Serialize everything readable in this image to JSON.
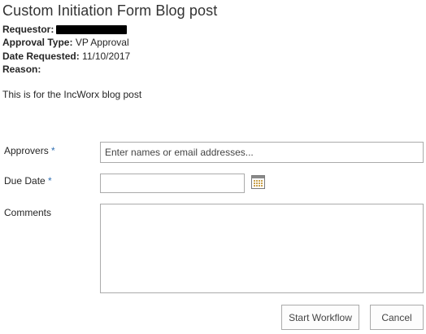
{
  "page": {
    "title": "Custom Initiation Form Blog post"
  },
  "info": {
    "requestor_label": "Requestor:",
    "approval_type_label": "Approval Type:",
    "approval_type_value": "VP Approval",
    "date_requested_label": "Date Requested:",
    "date_requested_value": "11/10/2017",
    "reason_label": "Reason:",
    "reason_value": "This is for the IncWorx blog post"
  },
  "form": {
    "approvers_label": "Approvers",
    "approvers_placeholder": "Enter names or email addresses...",
    "approvers_value": "",
    "due_date_label": "Due Date",
    "due_date_value": "",
    "comments_label": "Comments",
    "comments_value": "",
    "required_marker": "*",
    "calendar_icon": "calendar-icon"
  },
  "actions": {
    "start_label": "Start Workflow",
    "cancel_label": "Cancel"
  },
  "colors": {
    "required_marker": "#2f6fb2",
    "field_border": "#ababab"
  }
}
